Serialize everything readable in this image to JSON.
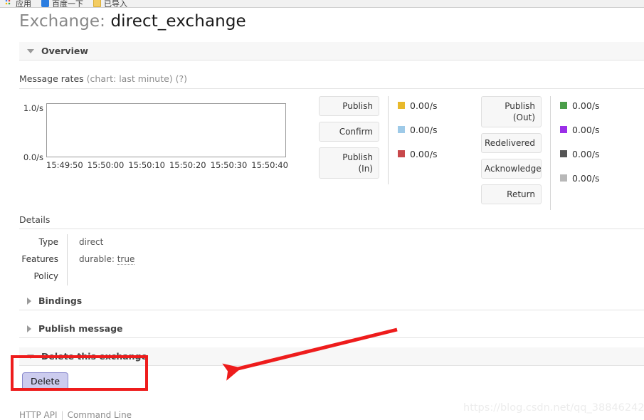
{
  "browser": {
    "bookmarks": [
      {
        "icon": "grid-icon",
        "label": "应用"
      },
      {
        "icon": "baidu-icon",
        "label": "百度一下"
      },
      {
        "icon": "folder-icon",
        "label": "已导入"
      }
    ]
  },
  "page": {
    "title_prefix": "Exchange: ",
    "exchange_name": "direct_exchange"
  },
  "overview": {
    "header": "Overview",
    "rates_label": "Message rates",
    "rates_suffix": " (chart: last minute) (?)"
  },
  "chart_data": {
    "type": "line",
    "title": "Message rates (chart: last minute)",
    "xlabel": "",
    "ylabel": "",
    "ylim": [
      0.0,
      1.0
    ],
    "y_ticks": [
      "1.0/s",
      "0.0/s"
    ],
    "x_ticks": [
      "15:49:50",
      "15:50:00",
      "15:50:10",
      "15:50:20",
      "15:50:30",
      "15:50:40"
    ],
    "grid": false,
    "legend_position": "right",
    "series": [
      {
        "name": "Publish",
        "color": "#e8b92b",
        "value": "0.00/s",
        "values": []
      },
      {
        "name": "Confirm",
        "color": "#9ecae8",
        "value": "0.00/s",
        "values": []
      },
      {
        "name": "Publish\n(In)",
        "color": "#c8484b",
        "value": "0.00/s",
        "values": []
      },
      {
        "name": "Publish\n(Out)",
        "color": "#4a9e49",
        "value": "0.00/s",
        "values": []
      },
      {
        "name": "Redelivered",
        "color": "#9b2fe8",
        "value": "0.00/s",
        "values": []
      },
      {
        "name": "Acknowledge",
        "color": "#555555",
        "value": "0.00/s",
        "values": []
      },
      {
        "name": "Return",
        "color": "#b8b8b8",
        "value": "0.00/s",
        "values": []
      }
    ]
  },
  "legend_left": [
    {
      "label": "Publish",
      "value": "0.00/s",
      "color": "#e8b92b"
    },
    {
      "label": "Confirm",
      "value": "0.00/s",
      "color": "#9ecae8"
    },
    {
      "label": "Publish\n(In)",
      "value": "0.00/s",
      "color": "#c8484b"
    }
  ],
  "legend_right": [
    {
      "label": "Publish\n(Out)",
      "value": "0.00/s",
      "color": "#4a9e49"
    },
    {
      "label": "Redelivered",
      "value": "0.00/s",
      "color": "#9b2fe8"
    },
    {
      "label": "Acknowledge",
      "value": "0.00/s",
      "color": "#555555"
    },
    {
      "label": "Return",
      "value": "0.00/s",
      "color": "#b8b8b8"
    }
  ],
  "details": {
    "label": "Details",
    "rows": [
      {
        "label": "Type",
        "value": "direct"
      },
      {
        "label": "Features",
        "value_prefix": "durable: ",
        "value_dotted": "true"
      },
      {
        "label": "Policy",
        "value": ""
      }
    ]
  },
  "sections": [
    {
      "name": "Bindings",
      "expanded": false
    },
    {
      "name": "Publish message",
      "expanded": false
    },
    {
      "name": "Delete this exchange",
      "expanded": true
    }
  ],
  "delete": {
    "button_label": "Delete"
  },
  "footer": {
    "http_api": "HTTP API",
    "separator": "|",
    "command_line": "Command Line"
  },
  "watermark": {
    "text": "https://blog.csdn.net/qq_38846242"
  },
  "annotation": {
    "color": "#ee1c1c"
  }
}
